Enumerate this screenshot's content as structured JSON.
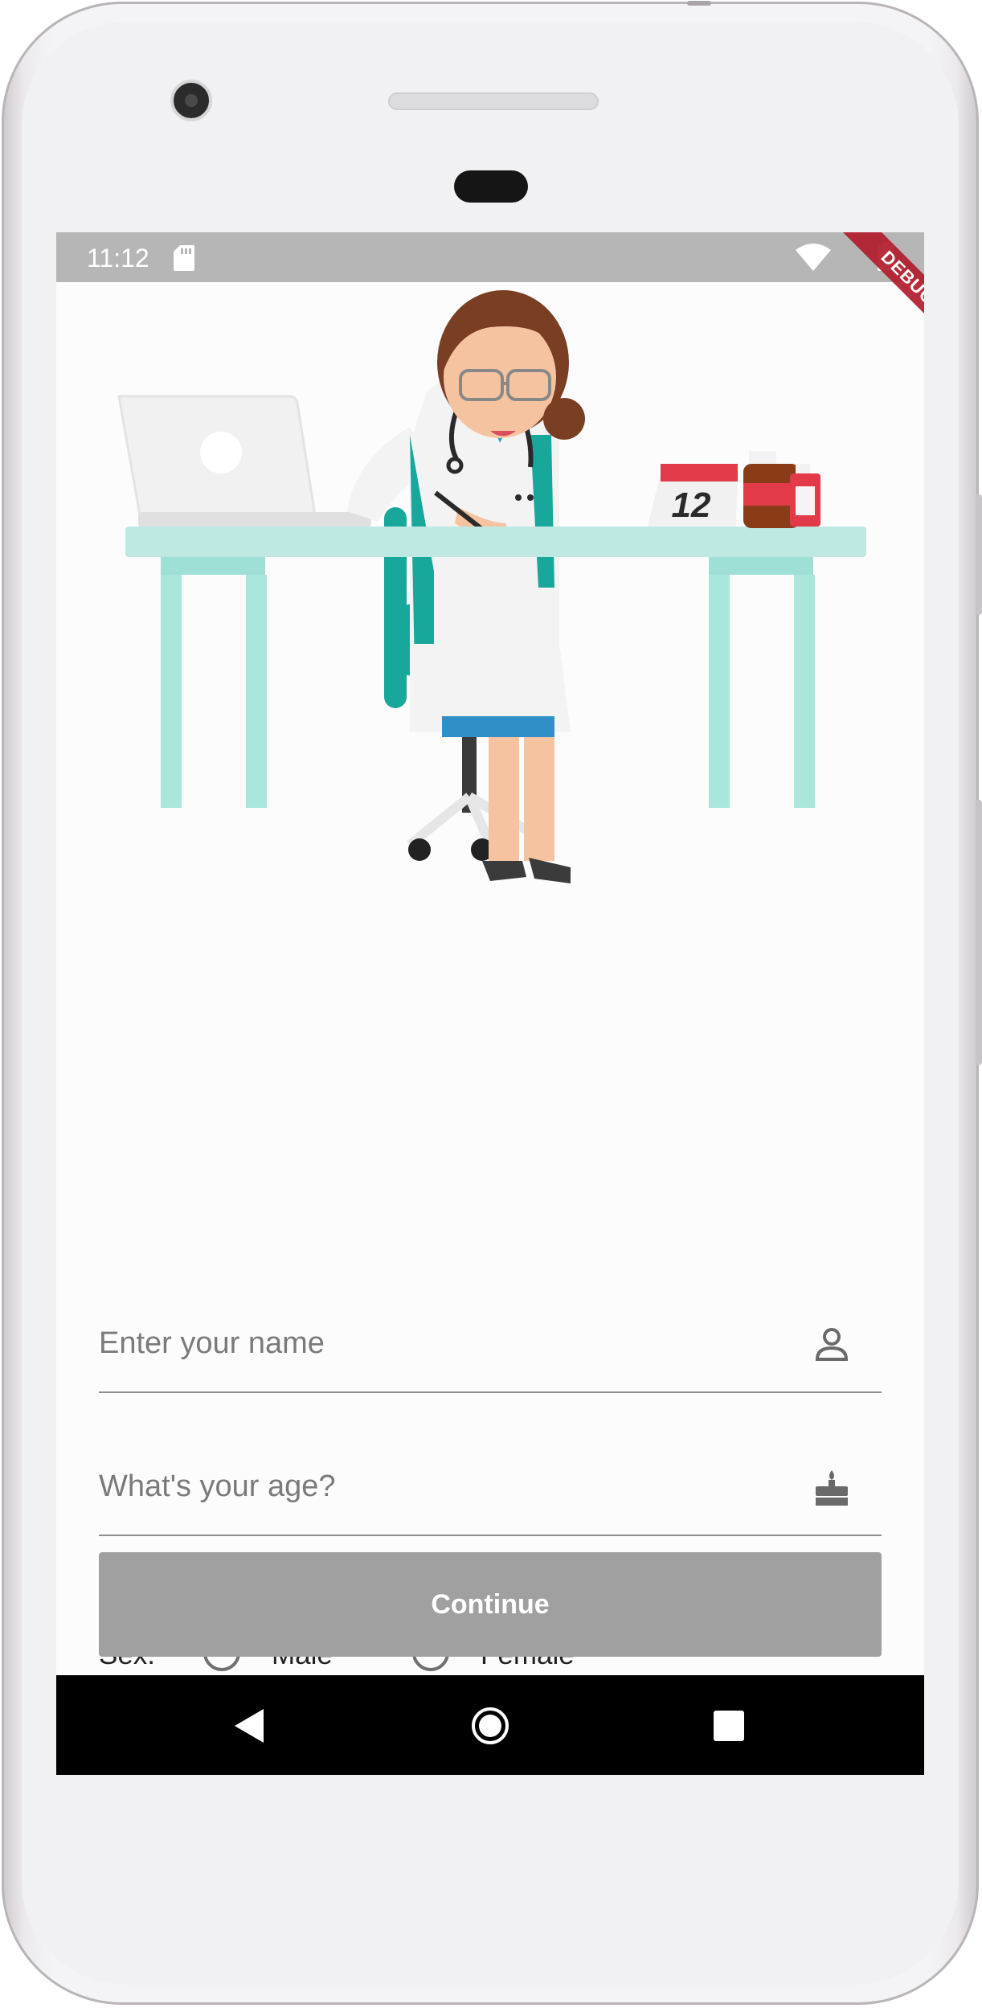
{
  "status_bar": {
    "time": "11:12",
    "icons": [
      "sd-card-icon",
      "wifi-icon",
      "battery-icon"
    ],
    "debug_banner": "DEBUG"
  },
  "illustration": {
    "subject": "doctor-at-desk",
    "calendar_day": "12"
  },
  "form": {
    "name": {
      "placeholder": "Enter your name",
      "value": "",
      "icon": "person-icon"
    },
    "age": {
      "placeholder": "What's your age?",
      "value": "",
      "icon": "cake-icon"
    },
    "sex": {
      "label": "Sex:",
      "options": [
        {
          "label": "Male",
          "selected": false
        },
        {
          "label": "Female",
          "selected": false
        }
      ]
    },
    "continue_label": "Continue"
  },
  "nav_bar": {
    "buttons": [
      "back-icon",
      "home-icon",
      "recents-icon"
    ]
  },
  "colors": {
    "status_bar": "#b6b6b6",
    "button_disabled": "#a0a0a0",
    "desk": "#bfe8e2",
    "chair": "#14a79a",
    "debug_banner": "#b31c2d"
  }
}
